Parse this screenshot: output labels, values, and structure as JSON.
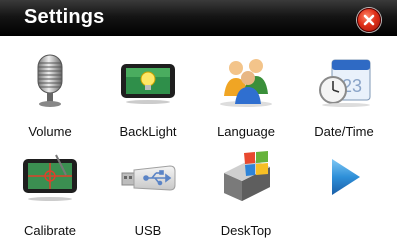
{
  "window": {
    "title": "Settings"
  },
  "header": {
    "close_icon": "close-icon"
  },
  "tiles": [
    {
      "label": "Volume",
      "icon": "microphone-icon"
    },
    {
      "label": "BackLight",
      "icon": "lightbulb-display-icon"
    },
    {
      "label": "Language",
      "icon": "people-icon"
    },
    {
      "label": "Date/Time",
      "icon": "calendar-clock-icon"
    },
    {
      "label": "Calibrate",
      "icon": "crosshair-display-icon"
    },
    {
      "label": "USB",
      "icon": "usb-drive-icon"
    },
    {
      "label": "DeskTop",
      "icon": "windows-logo-icon"
    },
    {
      "label": "",
      "icon": "next-arrow-icon"
    }
  ],
  "colors": {
    "titlebar": "#000000",
    "close": "#e0301a",
    "arrow": "#2e8fd8"
  }
}
